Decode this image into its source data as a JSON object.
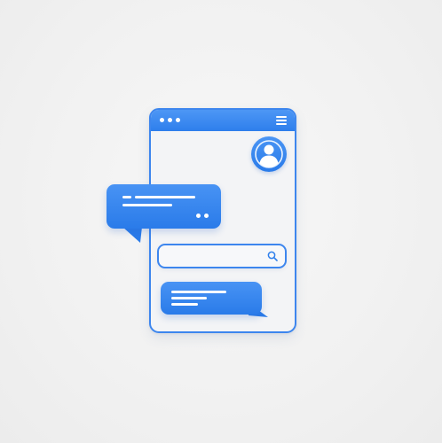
{
  "illustration": {
    "phone": {
      "header_dot_count": 3,
      "header_icon": "hamburger-menu-icon",
      "avatar_icon": "user-avatar-icon"
    },
    "search": {
      "icon": "search-icon",
      "value": "",
      "placeholder": ""
    },
    "incoming_message": {
      "text_line_count": 2,
      "typing_dots": 2
    },
    "outgoing_message": {
      "text_line_count": 3
    }
  },
  "colors": {
    "background": "#f1f1f1",
    "accent": "#2e7fec",
    "accent_light": "#4d97f5",
    "frame_fill": "#f3f4f6",
    "text_on_accent": "#ffffff"
  }
}
